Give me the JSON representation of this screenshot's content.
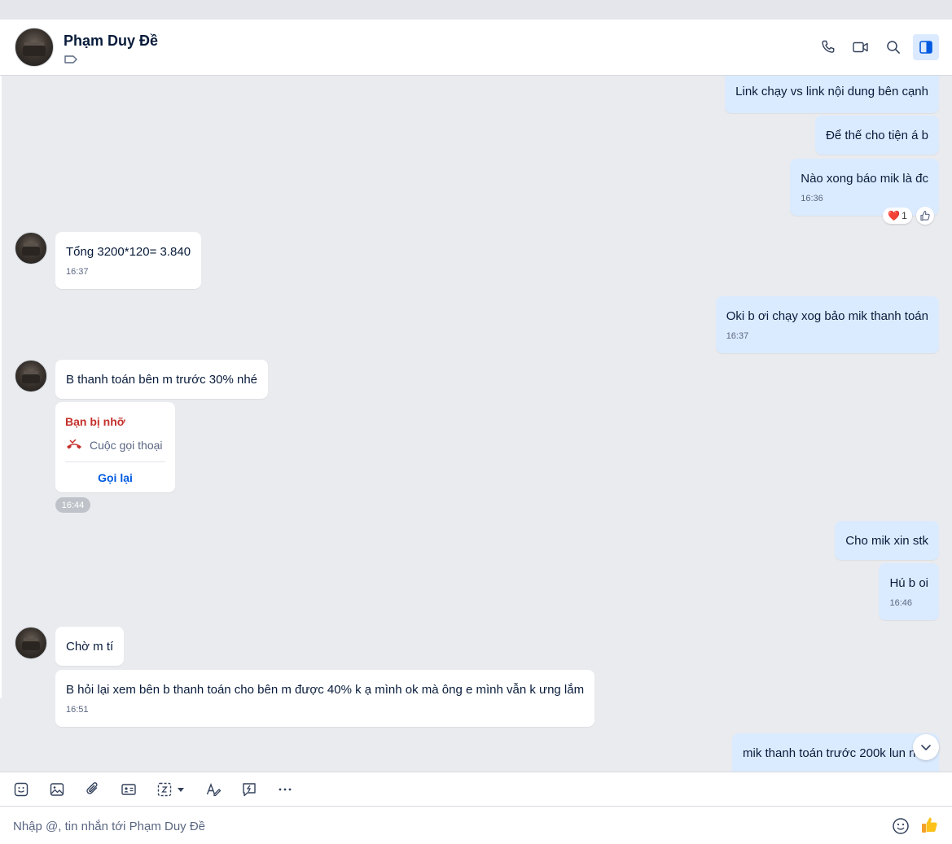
{
  "header": {
    "contact_name": "Phạm Duy Đề",
    "icons": [
      "phone-icon",
      "video-icon",
      "search-icon",
      "sidebar-toggle-icon"
    ]
  },
  "messages": [
    {
      "dir": "out",
      "text": "Link chạy vs link nội dung bên cạnh"
    },
    {
      "dir": "out",
      "text": "Để thế cho tiện á b"
    },
    {
      "dir": "out",
      "text": "Nào xong báo mik là đc",
      "time": "16:36",
      "reaction": {
        "emoji": "❤️",
        "count": "1"
      }
    },
    {
      "dir": "in",
      "text": "Tổng 3200*120= 3.840",
      "time": "16:37"
    },
    {
      "dir": "out",
      "text": "Oki b ơi chạy xog bảo mik thanh toán",
      "time": "16:37"
    },
    {
      "dir": "in",
      "text": "B thanh toán bên m trước 30% nhé"
    },
    {
      "dir": "out",
      "text": "Cho mik xin stk"
    },
    {
      "dir": "out",
      "text": "Hú b oi",
      "time": "16:46"
    },
    {
      "dir": "in",
      "text": "Chờ m tí"
    },
    {
      "dir": "in",
      "text": "B hỏi lại xem bên b thanh toán cho bên m được 40% k ạ mình ok mà ông e mình vẫn k ưng lắm",
      "time": "16:51"
    },
    {
      "dir": "out",
      "text": "mik thanh toán trước 200k lun n"
    }
  ],
  "missed_call": {
    "title": "Bạn bị nhỡ",
    "label": "Cuộc gọi thoại",
    "action": "Gọi lại",
    "time": "16:44"
  },
  "composer": {
    "placeholder": "Nhập @, tin nhắn tới Phạm Duy Đề",
    "toolbar_icons": [
      "sticker-icon",
      "image-icon",
      "attachment-icon",
      "contact-card-icon",
      "screenshot-icon",
      "dropdown-arrow-icon",
      "text-format-icon",
      "quick-message-icon",
      "more-icon"
    ]
  },
  "colors": {
    "accent": "#005ae0",
    "outgoing_bubble": "#dbebff",
    "incoming_bubble": "#ffffff",
    "missed_red": "#c4302b"
  }
}
